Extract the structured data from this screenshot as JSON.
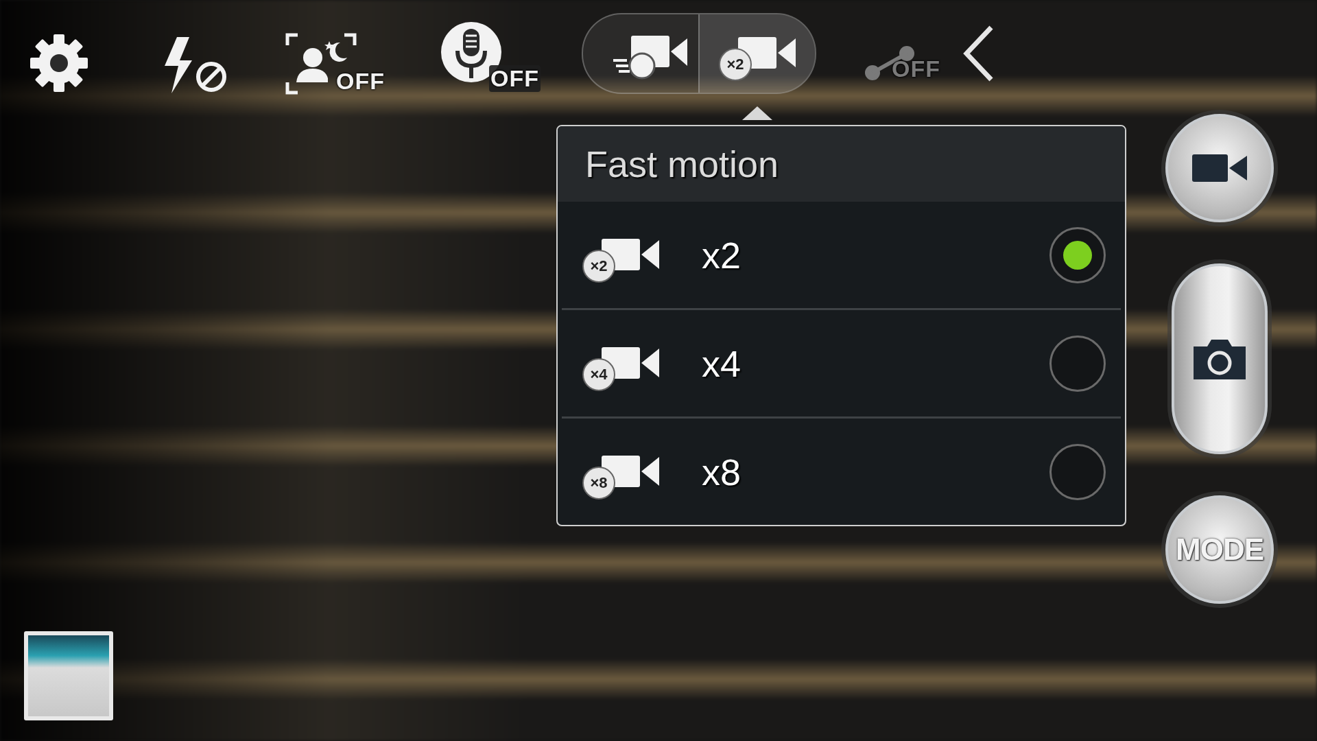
{
  "toolbar": [
    {
      "kind": "settings"
    },
    {
      "kind": "flash"
    },
    {
      "kind": "night",
      "badge": "OFF"
    },
    {
      "kind": "voice",
      "badge": "OFF"
    }
  ],
  "recording_modes": [
    {
      "kind": "slow",
      "selected": false
    },
    {
      "kind": "fast",
      "badge": "×2",
      "selected": true
    }
  ],
  "share": {
    "badge": "OFF",
    "disabled": true
  },
  "popup": {
    "title": "Fast motion",
    "options": [
      {
        "badge": "×2",
        "label": "x2",
        "selected": true
      },
      {
        "badge": "×4",
        "label": "x4",
        "selected": false
      },
      {
        "badge": "×8",
        "label": "x8",
        "selected": false
      }
    ]
  },
  "side_buttons": [
    {
      "kind": "record"
    },
    {
      "kind": "capture"
    },
    {
      "kind": "mode",
      "label": "MODE"
    }
  ]
}
